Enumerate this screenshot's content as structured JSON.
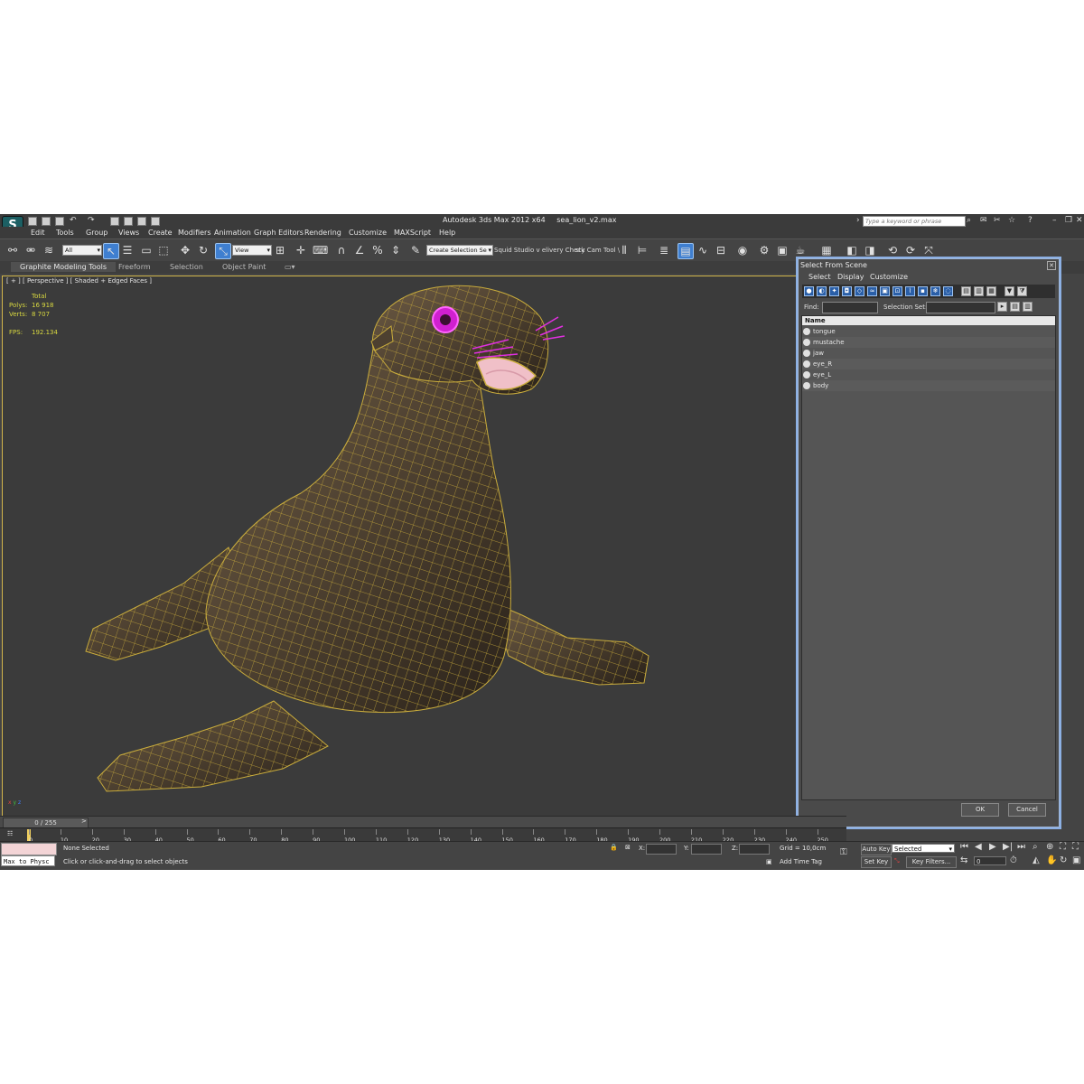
{
  "app": {
    "logo": "S",
    "title_app": "Autodesk 3ds Max  2012 x64",
    "title_file": "sea_lion_v2.max",
    "search_placeholder": "Type a keyword or phrase"
  },
  "menu": [
    "Edit",
    "Tools",
    "Group",
    "Views",
    "Create",
    "Modifiers",
    "Animation",
    "Graph Editors",
    "Rendering",
    "Customize",
    "MAXScript",
    "Help"
  ],
  "toolbar": {
    "filter_value": "All",
    "coord_value": "View",
    "selection_set": "Create Selection Se",
    "label_squid": "Squid Studio v elivery Check",
    "label_cam": "sty Cam Tool \\"
  },
  "ribbon": {
    "tabs": [
      "Graphite Modeling Tools",
      "Freeform",
      "Selection",
      "Object Paint"
    ]
  },
  "viewport": {
    "label": "[ + ] [ Perspective ] [ Shaded + Edged Faces ]",
    "stats_total": "Total",
    "polys_label": "Polys:",
    "polys_value": "16 918",
    "verts_label": "Verts:",
    "verts_value": "8 707",
    "fps_label": "FPS:",
    "fps_value": "192.134",
    "axis_x": "x",
    "axis_y": "y",
    "axis_z": "z"
  },
  "scene_panel": {
    "title": "Select From Scene",
    "menu": [
      "Select",
      "Display",
      "Customize"
    ],
    "find_label": "Find:",
    "selection_set_label": "Selection Set:",
    "column_name": "Name",
    "objects": [
      "tongue",
      "mustache",
      "jaw",
      "eye_R",
      "eye_L",
      "body"
    ],
    "ok_label": "OK",
    "cancel_label": "Cancel"
  },
  "timeline": {
    "slider": "0 / 255",
    "ticks": [
      "0",
      "10",
      "20",
      "30",
      "40",
      "50",
      "60",
      "70",
      "80",
      "90",
      "100",
      "110",
      "120",
      "130",
      "140",
      "150",
      "160",
      "170",
      "180",
      "190",
      "200",
      "210",
      "220",
      "230",
      "240",
      "250"
    ]
  },
  "status": {
    "maxscript": "Max to Physc",
    "none_selected": "None Selected",
    "prompt": "Click or click-and-drag to select objects",
    "x_label": "X:",
    "y_label": "Y:",
    "z_label": "Z:",
    "grid": "Grid = 10,0cm",
    "add_time_tag": "Add Time Tag",
    "auto_key": "Auto Key",
    "set_key": "Set Key",
    "key_mode": "Selected",
    "key_filters": "Key Filters...",
    "frame": "0"
  },
  "colors": {
    "accent": "#3f7fd0",
    "wire": "#d2b64b",
    "highlight": "#e040e0",
    "panel_border": "#8cb0e4"
  }
}
